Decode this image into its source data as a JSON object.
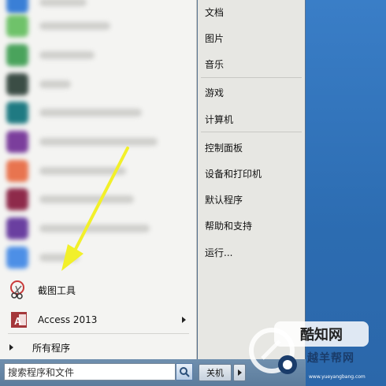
{
  "left_menu": {
    "programs": [
      {
        "label": "截图工具",
        "icon": "snipping-tool-icon"
      },
      {
        "label": "Access 2013",
        "icon": "access-icon",
        "has_submenu": true
      }
    ],
    "all_programs_label": "所有程序"
  },
  "search": {
    "placeholder": "搜索程序和文件"
  },
  "shutdown": {
    "label": "关机"
  },
  "right_menu": {
    "group1": [
      "文档",
      "图片",
      "音乐"
    ],
    "group2": [
      "游戏",
      "计算机"
    ],
    "group3": [
      "控制面板",
      "设备和打印机",
      "默认程序",
      "帮助和支持",
      "运行..."
    ]
  },
  "watermark": {
    "logo_text": "酷知网",
    "text": "越羊帮网",
    "url": "www.yueyangbang.com"
  },
  "colors": {
    "arrow": "#f2f02a",
    "desktop": "#2f6fb4",
    "menu_left": "#f4f4f2",
    "menu_right": "#e7e7e3"
  }
}
